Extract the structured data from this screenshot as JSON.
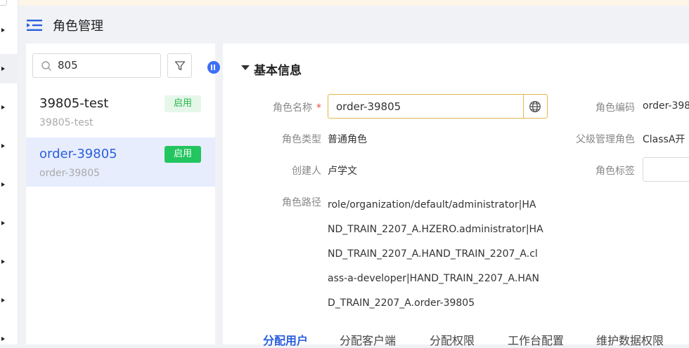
{
  "header": {
    "title": "角色管理"
  },
  "sidebar": {
    "search_value": "805",
    "items": [
      {
        "name": "39805-test",
        "code": "39805-test",
        "status": "启用"
      },
      {
        "name": "order-39805",
        "code": "order-39805",
        "status": "启用"
      }
    ]
  },
  "detail": {
    "section_title": "基本信息",
    "fields": {
      "role_name_label": "角色名称",
      "required_mark": "*",
      "role_name_value": "order-39805",
      "role_code_label": "角色编码",
      "role_code_value": "order-398",
      "role_type_label": "角色类型",
      "role_type_value": "普通角色",
      "parent_role_label": "父级管理角色",
      "parent_role_value": "ClassA开",
      "creator_label": "创建人",
      "creator_value": "卢学文",
      "role_tag_label": "角色标签",
      "role_path_label": "角色路径",
      "role_path_lines": [
        "role/organization/default/administrator|HA",
        "ND_TRAIN_2207_A.HZERO.administrator|HA",
        "ND_TRAIN_2207_A.HAND_TRAIN_2207_A.cl",
        "ass-a-developer|HAND_TRAIN_2207_A.HAN",
        "D_TRAIN_2207_A.order-39805"
      ]
    },
    "tabs": [
      "分配用户",
      "分配客户端",
      "分配权限",
      "工作台配置",
      "维护数据权限"
    ]
  },
  "colors": {
    "accent": "#2b5fde",
    "enabled_green": "#22c55e",
    "focus_border": "#e0b84c"
  }
}
